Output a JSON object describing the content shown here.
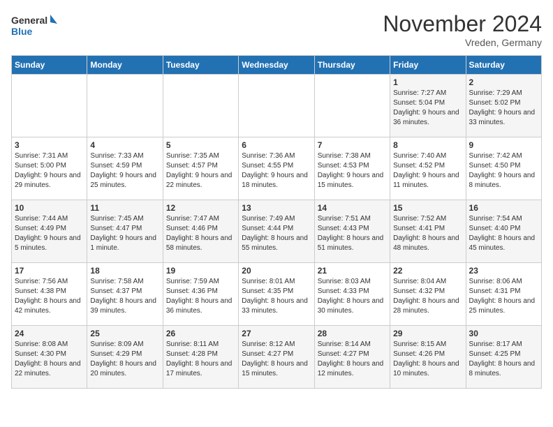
{
  "header": {
    "logo_general": "General",
    "logo_blue": "Blue",
    "month_title": "November 2024",
    "location": "Vreden, Germany"
  },
  "weekdays": [
    "Sunday",
    "Monday",
    "Tuesday",
    "Wednesday",
    "Thursday",
    "Friday",
    "Saturday"
  ],
  "weeks": [
    [
      {
        "day": "",
        "info": ""
      },
      {
        "day": "",
        "info": ""
      },
      {
        "day": "",
        "info": ""
      },
      {
        "day": "",
        "info": ""
      },
      {
        "day": "",
        "info": ""
      },
      {
        "day": "1",
        "info": "Sunrise: 7:27 AM\nSunset: 5:04 PM\nDaylight: 9 hours and 36 minutes."
      },
      {
        "day": "2",
        "info": "Sunrise: 7:29 AM\nSunset: 5:02 PM\nDaylight: 9 hours and 33 minutes."
      }
    ],
    [
      {
        "day": "3",
        "info": "Sunrise: 7:31 AM\nSunset: 5:00 PM\nDaylight: 9 hours and 29 minutes."
      },
      {
        "day": "4",
        "info": "Sunrise: 7:33 AM\nSunset: 4:59 PM\nDaylight: 9 hours and 25 minutes."
      },
      {
        "day": "5",
        "info": "Sunrise: 7:35 AM\nSunset: 4:57 PM\nDaylight: 9 hours and 22 minutes."
      },
      {
        "day": "6",
        "info": "Sunrise: 7:36 AM\nSunset: 4:55 PM\nDaylight: 9 hours and 18 minutes."
      },
      {
        "day": "7",
        "info": "Sunrise: 7:38 AM\nSunset: 4:53 PM\nDaylight: 9 hours and 15 minutes."
      },
      {
        "day": "8",
        "info": "Sunrise: 7:40 AM\nSunset: 4:52 PM\nDaylight: 9 hours and 11 minutes."
      },
      {
        "day": "9",
        "info": "Sunrise: 7:42 AM\nSunset: 4:50 PM\nDaylight: 9 hours and 8 minutes."
      }
    ],
    [
      {
        "day": "10",
        "info": "Sunrise: 7:44 AM\nSunset: 4:49 PM\nDaylight: 9 hours and 5 minutes."
      },
      {
        "day": "11",
        "info": "Sunrise: 7:45 AM\nSunset: 4:47 PM\nDaylight: 9 hours and 1 minute."
      },
      {
        "day": "12",
        "info": "Sunrise: 7:47 AM\nSunset: 4:46 PM\nDaylight: 8 hours and 58 minutes."
      },
      {
        "day": "13",
        "info": "Sunrise: 7:49 AM\nSunset: 4:44 PM\nDaylight: 8 hours and 55 minutes."
      },
      {
        "day": "14",
        "info": "Sunrise: 7:51 AM\nSunset: 4:43 PM\nDaylight: 8 hours and 51 minutes."
      },
      {
        "day": "15",
        "info": "Sunrise: 7:52 AM\nSunset: 4:41 PM\nDaylight: 8 hours and 48 minutes."
      },
      {
        "day": "16",
        "info": "Sunrise: 7:54 AM\nSunset: 4:40 PM\nDaylight: 8 hours and 45 minutes."
      }
    ],
    [
      {
        "day": "17",
        "info": "Sunrise: 7:56 AM\nSunset: 4:38 PM\nDaylight: 8 hours and 42 minutes."
      },
      {
        "day": "18",
        "info": "Sunrise: 7:58 AM\nSunset: 4:37 PM\nDaylight: 8 hours and 39 minutes."
      },
      {
        "day": "19",
        "info": "Sunrise: 7:59 AM\nSunset: 4:36 PM\nDaylight: 8 hours and 36 minutes."
      },
      {
        "day": "20",
        "info": "Sunrise: 8:01 AM\nSunset: 4:35 PM\nDaylight: 8 hours and 33 minutes."
      },
      {
        "day": "21",
        "info": "Sunrise: 8:03 AM\nSunset: 4:33 PM\nDaylight: 8 hours and 30 minutes."
      },
      {
        "day": "22",
        "info": "Sunrise: 8:04 AM\nSunset: 4:32 PM\nDaylight: 8 hours and 28 minutes."
      },
      {
        "day": "23",
        "info": "Sunrise: 8:06 AM\nSunset: 4:31 PM\nDaylight: 8 hours and 25 minutes."
      }
    ],
    [
      {
        "day": "24",
        "info": "Sunrise: 8:08 AM\nSunset: 4:30 PM\nDaylight: 8 hours and 22 minutes."
      },
      {
        "day": "25",
        "info": "Sunrise: 8:09 AM\nSunset: 4:29 PM\nDaylight: 8 hours and 20 minutes."
      },
      {
        "day": "26",
        "info": "Sunrise: 8:11 AM\nSunset: 4:28 PM\nDaylight: 8 hours and 17 minutes."
      },
      {
        "day": "27",
        "info": "Sunrise: 8:12 AM\nSunset: 4:27 PM\nDaylight: 8 hours and 15 minutes."
      },
      {
        "day": "28",
        "info": "Sunrise: 8:14 AM\nSunset: 4:27 PM\nDaylight: 8 hours and 12 minutes."
      },
      {
        "day": "29",
        "info": "Sunrise: 8:15 AM\nSunset: 4:26 PM\nDaylight: 8 hours and 10 minutes."
      },
      {
        "day": "30",
        "info": "Sunrise: 8:17 AM\nSunset: 4:25 PM\nDaylight: 8 hours and 8 minutes."
      }
    ]
  ]
}
